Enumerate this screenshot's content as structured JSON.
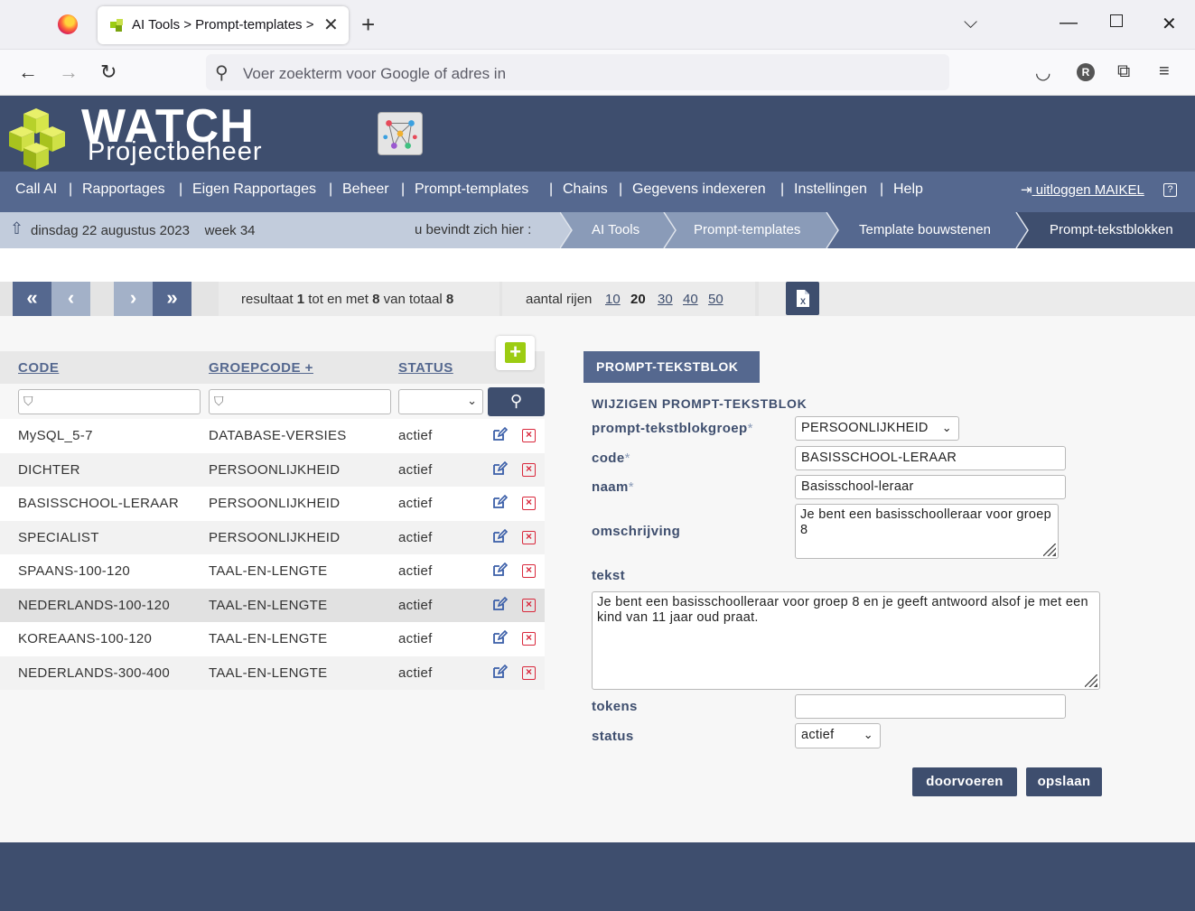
{
  "browser": {
    "tab_title": "AI Tools > Prompt-templates >",
    "address_placeholder": "Voer zoekterm voor Google of adres in",
    "profile_initial": "R"
  },
  "app": {
    "logo_title": "WATCH",
    "logo_subtitle": "Projectbeheer",
    "menu": [
      "Call AI",
      "Rapportages",
      "Eigen Rapportages",
      "Beheer",
      "Prompt-templates",
      "Chains",
      "Gegevens indexeren",
      "Instellingen",
      "Help"
    ],
    "logout_label": "uitloggen MAIKEL",
    "help_icon": "?"
  },
  "crumbbar": {
    "date": "dinsdag 22 augustus 2023",
    "week": "week 34",
    "where_label": "u bevindt zich hier :",
    "crumbs": [
      "AI Tools",
      "Prompt-templates",
      "Template bouwstenen",
      "Prompt-tekstblokken"
    ]
  },
  "pager": {
    "result_prefix": "resultaat",
    "from": "1",
    "mid1": "tot en met",
    "to": "8",
    "mid2": "van totaal",
    "total": "8",
    "rows_label": "aantal rijen",
    "rows_options": [
      "10",
      "20",
      "30",
      "40",
      "50"
    ],
    "rows_selected": "20"
  },
  "list": {
    "columns": {
      "code": "CODE",
      "groepcode": "GROEPCODE +",
      "status": "STATUS"
    },
    "rows": [
      {
        "code": "MySQL_5-7",
        "groep": "DATABASE-VERSIES",
        "status": "actief"
      },
      {
        "code": "DICHTER",
        "groep": "PERSOONLIJKHEID",
        "status": "actief"
      },
      {
        "code": "BASISSCHOOL-LERAAR",
        "groep": "PERSOONLIJKHEID",
        "status": "actief"
      },
      {
        "code": "SPECIALIST",
        "groep": "PERSOONLIJKHEID",
        "status": "actief"
      },
      {
        "code": "SPAANS-100-120",
        "groep": "TAAL-EN-LENGTE",
        "status": "actief"
      },
      {
        "code": "NEDERLANDS-100-120",
        "groep": "TAAL-EN-LENGTE",
        "status": "actief"
      },
      {
        "code": "KOREAANS-100-120",
        "groep": "TAAL-EN-LENGTE",
        "status": "actief"
      },
      {
        "code": "NEDERLANDS-300-400",
        "groep": "TAAL-EN-LENGTE",
        "status": "actief"
      }
    ]
  },
  "form": {
    "title": "PROMPT-TEKSTBLOK",
    "subtitle": "WIJZIGEN PROMPT-TEKSTBLOK",
    "labels": {
      "groep": "prompt-tekstblokgroep",
      "code": "code",
      "naam": "naam",
      "omschrijving": "omschrijving",
      "tekst": "tekst",
      "tokens": "tokens",
      "status": "status"
    },
    "required_mark": "*",
    "values": {
      "groep": "PERSOONLIJKHEID",
      "code": "BASISSCHOOL-LERAAR",
      "naam": "Basisschool-leraar",
      "omschrijving": "Je bent een basisschoolleraar voor groep 8",
      "tekst": "Je bent een basisschoolleraar voor groep 8 en je geeft antwoord alsof je met een kind van 11 jaar oud praat.",
      "tokens": "",
      "status": "actief"
    },
    "buttons": {
      "doorvoeren": "doorvoeren",
      "opslaan": "opslaan"
    }
  },
  "colors": {
    "header_bg": "#3e4e6e",
    "menu_bg": "#55688f",
    "crumb_bg": "#c2ccdc",
    "accent_green": "#9ccc12",
    "delete_red": "#d9283c"
  }
}
